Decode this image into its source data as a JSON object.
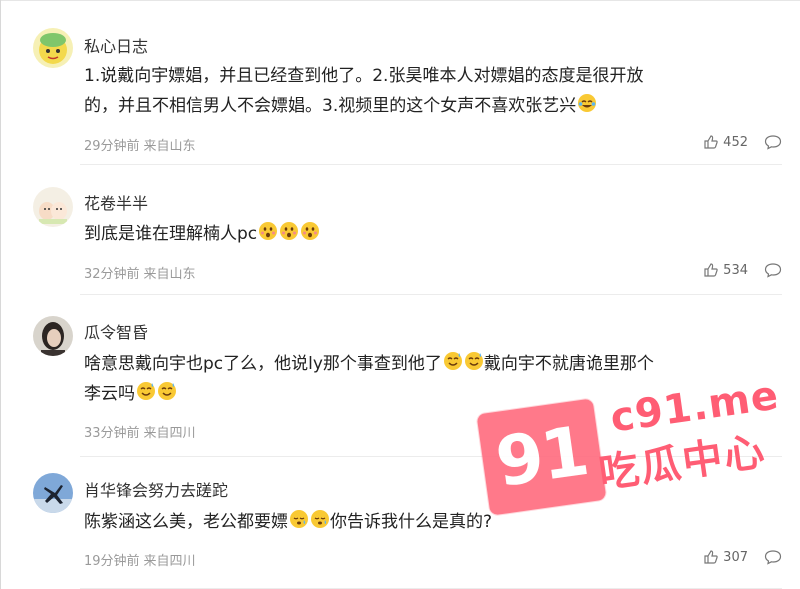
{
  "comments": [
    {
      "username": "私心日志",
      "text_lines": [
        "1.说戴向宇嫖娼，并且已经查到他了。2.张昊唯本人对嫖娼的态度是很开放",
        "的，并且不相信男人不会嫖娼。3.视频里的这个女声不喜欢张艺兴"
      ],
      "emojis_after_text": [
        "laughing-tears-emoji"
      ],
      "time": "29分钟前",
      "location": "来自山东",
      "likes": "452"
    },
    {
      "username": "花卷半半",
      "text_lines": [
        "到底是谁在理解楠人pc"
      ],
      "emojis_after_text": [
        "surprised-emoji",
        "surprised-emoji",
        "surprised-emoji"
      ],
      "time": "32分钟前",
      "location": "来自山东",
      "likes": "534"
    },
    {
      "username": "瓜令智昏",
      "text_parts": [
        "啥意思戴向宇也pc了么，他说ly那个事查到他了",
        "戴向宇不就唐诡里那个",
        "李云吗"
      ],
      "time": "33分钟前",
      "location": "来自四川",
      "likes": ""
    },
    {
      "username": "肖华锋会努力去蹉跎",
      "text_parts": [
        "陈紫涵这么美，老公都要嫖",
        "你告诉我什么是真的?"
      ],
      "time": "19分钟前",
      "location": "来自四川",
      "likes": "307"
    }
  ],
  "watermark": {
    "number": "91",
    "domain": "c91.me",
    "name": "吃瓜中心"
  },
  "colors": {
    "watermark": "#ff5d74",
    "meta": "#9a9a9a",
    "text": "#222222"
  }
}
